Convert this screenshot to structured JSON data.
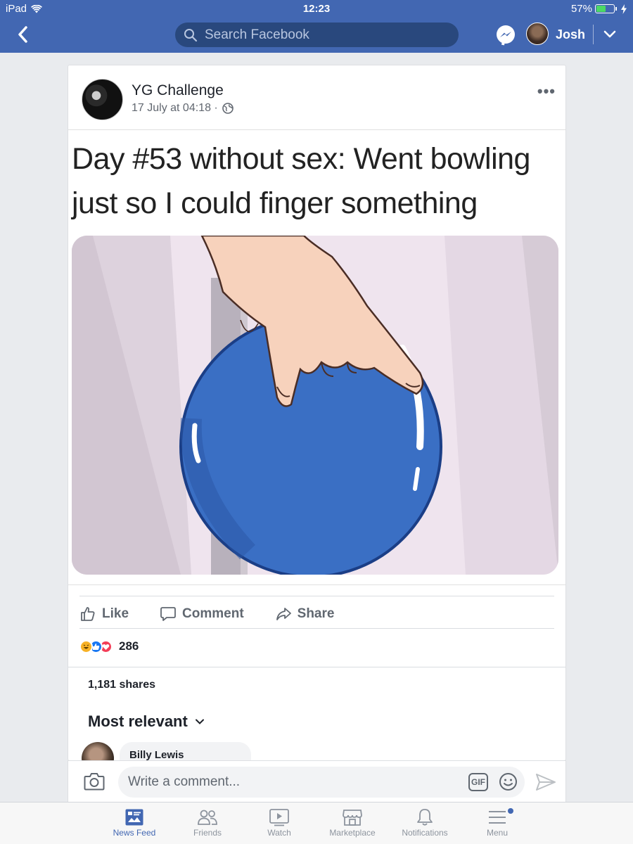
{
  "status": {
    "device": "iPad",
    "time": "12:23",
    "battery": "57%",
    "battery_level": 0.57
  },
  "header": {
    "search_placeholder": "Search Facebook",
    "user_name": "Josh"
  },
  "post": {
    "author": "YG Challenge",
    "timestamp": "17 July at 04:18 ·",
    "more": "•••",
    "meme_caption_line1": "Day #53 without sex: Went bowling",
    "meme_caption_line2": "just so I could finger something",
    "actions": {
      "like": "Like",
      "comment": "Comment",
      "share": "Share"
    },
    "reaction_count": "286",
    "shares": "1,181 shares",
    "sort_label": "Most relevant",
    "first_commenter": "Billy Lewis"
  },
  "composer": {
    "placeholder": "Write a comment...",
    "gif": "GIF"
  },
  "tabs": [
    {
      "label": "News Feed"
    },
    {
      "label": "Friends"
    },
    {
      "label": "Watch"
    },
    {
      "label": "Marketplace"
    },
    {
      "label": "Notifications"
    },
    {
      "label": "Menu"
    }
  ],
  "colors": {
    "brand": "#4267b2",
    "ball": "#3a6fc4"
  }
}
